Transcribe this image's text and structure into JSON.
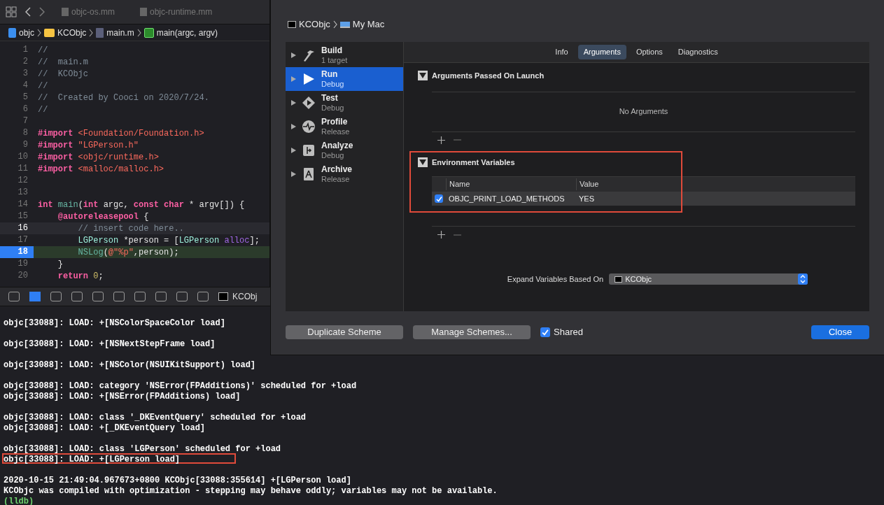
{
  "editor": {
    "tabs": [
      {
        "label": "objc-os.mm",
        "selected": false
      },
      {
        "label": "objc-runtime.mm",
        "selected": false
      }
    ],
    "breadcrumb": [
      {
        "kind": "project",
        "label": "objc"
      },
      {
        "kind": "folder",
        "label": "KCObjc"
      },
      {
        "kind": "file",
        "label": "main.m"
      },
      {
        "kind": "function",
        "label": "main(argc, argv)"
      }
    ],
    "lines": [
      {
        "number": "1",
        "current": false,
        "breakpoint": false,
        "tokens": [
          {
            "kind": "comment",
            "text": "//"
          }
        ]
      },
      {
        "number": "2",
        "current": false,
        "breakpoint": false,
        "tokens": [
          {
            "kind": "comment",
            "text": "//  main.m"
          }
        ]
      },
      {
        "number": "3",
        "current": false,
        "breakpoint": false,
        "tokens": [
          {
            "kind": "comment",
            "text": "//  KCObjc"
          }
        ]
      },
      {
        "number": "4",
        "current": false,
        "breakpoint": false,
        "tokens": [
          {
            "kind": "comment",
            "text": "//"
          }
        ]
      },
      {
        "number": "5",
        "current": false,
        "breakpoint": false,
        "tokens": [
          {
            "kind": "comment",
            "text": "//  Created by Cooci on 2020/7/24."
          }
        ]
      },
      {
        "number": "6",
        "current": false,
        "breakpoint": false,
        "tokens": [
          {
            "kind": "comment",
            "text": "//"
          }
        ]
      },
      {
        "number": "7",
        "current": false,
        "breakpoint": false
      },
      {
        "number": "8",
        "current": false,
        "breakpoint": false,
        "tokens": [
          {
            "kind": "keyword",
            "text": "#import "
          },
          {
            "kind": "string",
            "text": "<Foundation/Foundation.h>"
          }
        ]
      },
      {
        "number": "9",
        "current": false,
        "breakpoint": false,
        "tokens": [
          {
            "kind": "keyword",
            "text": "#import "
          },
          {
            "kind": "string",
            "text": "\"LGPerson.h\""
          }
        ]
      },
      {
        "number": "10",
        "current": false,
        "breakpoint": false,
        "tokens": [
          {
            "kind": "keyword",
            "text": "#import "
          },
          {
            "kind": "string",
            "text": "<objc/runtime.h>"
          }
        ]
      },
      {
        "number": "11",
        "current": false,
        "breakpoint": false,
        "tokens": [
          {
            "kind": "keyword",
            "text": "#import "
          },
          {
            "kind": "string",
            "text": "<malloc/malloc.h>"
          }
        ]
      },
      {
        "number": "12",
        "current": false,
        "breakpoint": false
      },
      {
        "number": "13",
        "current": false,
        "breakpoint": false
      },
      {
        "number": "14",
        "current": false,
        "breakpoint": false,
        "tokens": [
          {
            "kind": "keyword",
            "text": "int "
          },
          {
            "kind": "function",
            "text": "main"
          },
          {
            "kind": "plain",
            "text": "("
          },
          {
            "kind": "keyword",
            "text": "int "
          },
          {
            "kind": "plain",
            "text": "argc, "
          },
          {
            "kind": "keyword",
            "text": "const char "
          },
          {
            "kind": "plain",
            "text": "* argv[]) {"
          }
        ]
      },
      {
        "number": "15",
        "current": false,
        "breakpoint": false,
        "tokens": [
          {
            "kind": "keyword",
            "text": "    @autoreleasepool "
          },
          {
            "kind": "plain",
            "text": "{"
          }
        ]
      },
      {
        "number": "16",
        "current": true,
        "breakpoint": false,
        "tokens": [
          {
            "kind": "comment",
            "text": "        // insert code here.."
          }
        ]
      },
      {
        "number": "17",
        "current": false,
        "breakpoint": false,
        "tokens": [
          {
            "kind": "type",
            "text": "        LGPerson "
          },
          {
            "kind": "plain",
            "text": "*person = ["
          },
          {
            "kind": "type",
            "text": "LGPerson "
          },
          {
            "kind": "method",
            "text": "alloc"
          },
          {
            "kind": "plain",
            "text": "];"
          }
        ]
      },
      {
        "number": "18",
        "current": false,
        "breakpoint": true,
        "tokens": [
          {
            "kind": "function",
            "text": "        NSLog"
          },
          {
            "kind": "plain",
            "text": "("
          },
          {
            "kind": "string",
            "text": "@\"%p\""
          },
          {
            "kind": "plain",
            "text": ",person);"
          }
        ]
      },
      {
        "number": "19",
        "current": false,
        "breakpoint": false,
        "tokens": [
          {
            "kind": "plain",
            "text": "    }"
          }
        ]
      },
      {
        "number": "20",
        "current": false,
        "breakpoint": false,
        "tokens": [
          {
            "kind": "keyword",
            "text": "    return "
          },
          {
            "kind": "number",
            "text": "0"
          },
          {
            "kind": "plain",
            "text": ";"
          }
        ]
      }
    ]
  },
  "debug_bar": {
    "process": "KCObj"
  },
  "console": {
    "blocks": [
      [
        {
          "text": "objc[33088]: LOAD: +[NSColorSpaceColor load]",
          "highlighted": false,
          "kind": "output"
        }
      ],
      [
        {
          "text": "objc[33088]: LOAD: +[NSNextStepFrame load]",
          "highlighted": false,
          "kind": "output"
        }
      ],
      [
        {
          "text": "objc[33088]: LOAD: +[NSColor(NSUIKitSupport) load]",
          "highlighted": false,
          "kind": "output"
        }
      ],
      [
        {
          "text": "objc[33088]: LOAD: category 'NSError(FPAdditions)' scheduled for +load",
          "highlighted": false,
          "kind": "output"
        },
        {
          "text": "objc[33088]: LOAD: +[NSError(FPAdditions) load]",
          "highlighted": false,
          "kind": "output"
        }
      ],
      [
        {
          "text": "objc[33088]: LOAD: class '_DKEventQuery' scheduled for +load",
          "highlighted": false,
          "kind": "output"
        },
        {
          "text": "objc[33088]: LOAD: +[_DKEventQuery load]",
          "highlighted": false,
          "kind": "output"
        }
      ],
      [
        {
          "text": "objc[33088]: LOAD: class 'LGPerson' scheduled for +load",
          "highlighted": false,
          "kind": "output"
        },
        {
          "text": "objc[33088]: LOAD: +[LGPerson load]",
          "highlighted": true,
          "kind": "output"
        }
      ],
      [
        {
          "text": "2020-10-15 21:49:04.967673+0800 KCObjc[33088:355614] +[LGPerson load]",
          "highlighted": false,
          "kind": "output"
        },
        {
          "text": "KCObjc was compiled with optimization - stepping may behave oddly; variables may not be available.",
          "highlighted": false,
          "kind": "output"
        },
        {
          "text": "(lldb)",
          "highlighted": false,
          "kind": "prompt"
        }
      ]
    ]
  },
  "scheme_dialog": {
    "target": "KCObjc",
    "destination": "My Mac",
    "actions": [
      {
        "kind": "build",
        "name": "Build",
        "detail": "1 target",
        "selected": false
      },
      {
        "kind": "run",
        "name": "Run",
        "detail": "Debug",
        "selected": true
      },
      {
        "kind": "test",
        "name": "Test",
        "detail": "Debug",
        "selected": false
      },
      {
        "kind": "profile",
        "name": "Profile",
        "detail": "Release",
        "selected": false
      },
      {
        "kind": "analyze",
        "name": "Analyze",
        "detail": "Debug",
        "selected": false
      },
      {
        "kind": "archive",
        "name": "Archive",
        "detail": "Release",
        "selected": false
      }
    ],
    "tabs": [
      {
        "label": "Info",
        "selected": false
      },
      {
        "label": "Arguments",
        "selected": true
      },
      {
        "label": "Options",
        "selected": false
      },
      {
        "label": "Diagnostics",
        "selected": false
      }
    ],
    "arguments": {
      "title": "Arguments Passed On Launch",
      "expanded": true,
      "empty_text": "No Arguments"
    },
    "environment": {
      "title": "Environment Variables",
      "expanded": true,
      "highlighted": true,
      "columns": [
        "Name",
        "Value"
      ],
      "rows": [
        {
          "checked": true,
          "name": "OBJC_PRINT_LOAD_METHODS",
          "value": "YES"
        }
      ]
    },
    "expand_label": "Expand Variables Based On",
    "expand_value": "KCObjc",
    "footer": {
      "duplicate": "Duplicate Scheme",
      "manage": "Manage Schemes...",
      "shared_label": "Shared",
      "shared": true,
      "close": "Close"
    }
  }
}
